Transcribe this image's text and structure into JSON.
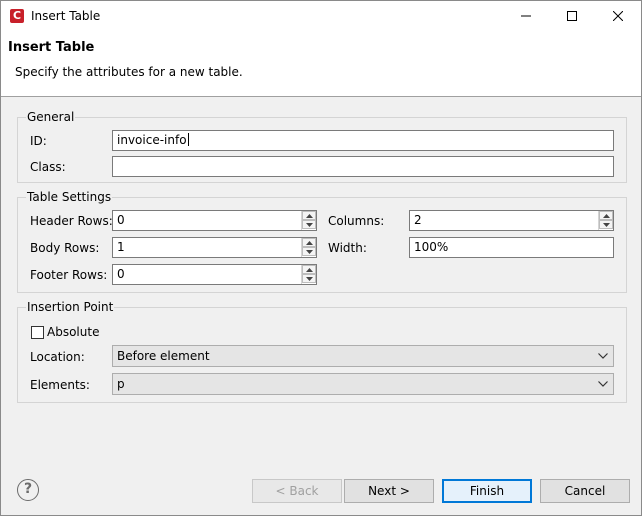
{
  "window": {
    "title": "Insert Table",
    "app_icon_letter": "C",
    "brand_color": "#c8202a"
  },
  "header": {
    "title": "Insert Table",
    "subtitle": "Specify the attributes for a new table."
  },
  "general": {
    "group_label": "General",
    "id_label": "ID:",
    "id_value": "invoice-info",
    "class_label": "Class:",
    "class_value": ""
  },
  "table_settings": {
    "group_label": "Table Settings",
    "header_rows_label": "Header Rows:",
    "header_rows_value": "0",
    "body_rows_label": "Body Rows:",
    "body_rows_value": "1",
    "footer_rows_label": "Footer Rows:",
    "footer_rows_value": "0",
    "columns_label": "Columns:",
    "columns_value": "2",
    "width_label": "Width:",
    "width_value": "100%"
  },
  "insertion_point": {
    "group_label": "Insertion Point",
    "absolute_label": "Absolute",
    "absolute_checked": false,
    "location_label": "Location:",
    "location_value": "Before element",
    "elements_label": "Elements:",
    "elements_value": "p"
  },
  "footer": {
    "help_glyph": "?",
    "back_label": "< Back",
    "next_label": "Next >",
    "finish_label": "Finish",
    "cancel_label": "Cancel"
  },
  "icons": {
    "help": "help-icon",
    "minimize": "minimize-icon",
    "maximize": "maximize-icon",
    "close": "close-icon"
  }
}
